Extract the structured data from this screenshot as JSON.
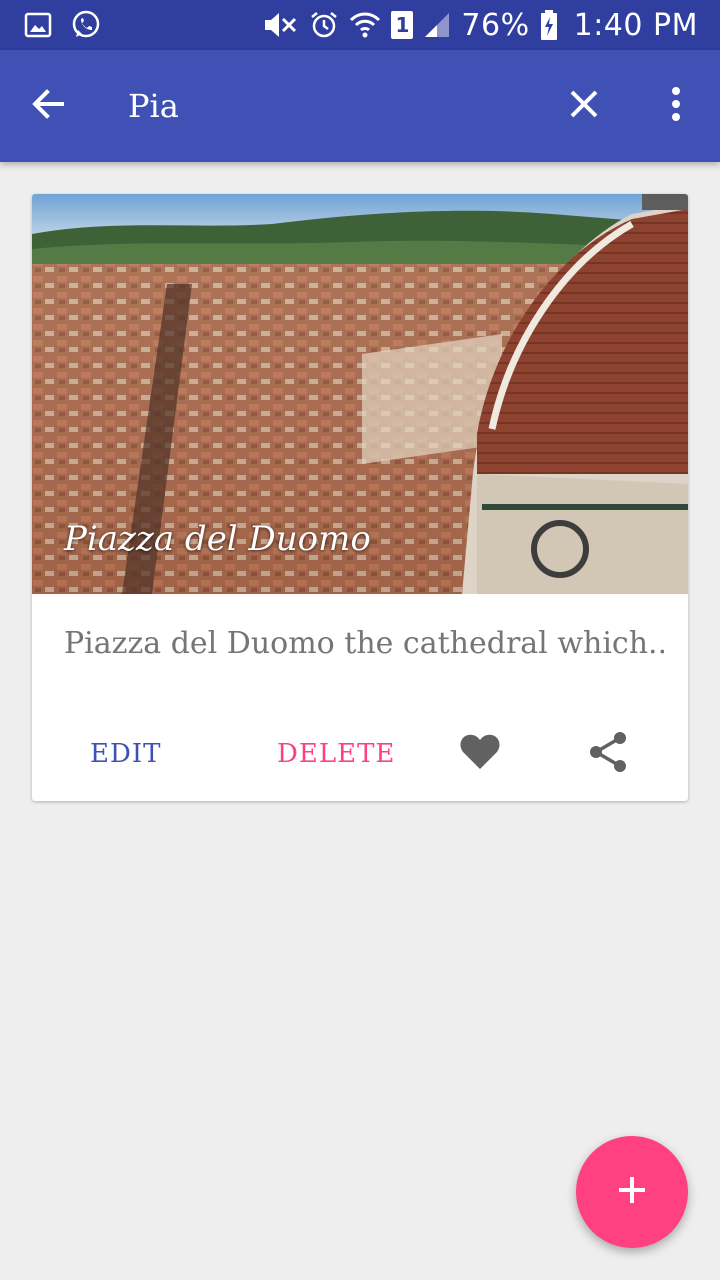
{
  "status_bar": {
    "battery": "76%",
    "time": "1:40 PM",
    "sim_slot": "1",
    "icons": [
      "gallery-icon",
      "whatsapp-icon",
      "vibrate-icon",
      "alarm-icon",
      "wifi-icon",
      "sim-icon",
      "signal-icon",
      "battery-icon"
    ]
  },
  "app_bar": {
    "search_value": "Pia",
    "icons": [
      "back-arrow-icon",
      "close-icon",
      "more-vert-icon"
    ]
  },
  "card": {
    "title": "Piazza del Duomo",
    "description": "Piazza del Duomo the cathedral which...",
    "edit_label": "EDIT",
    "delete_label": "DELETE",
    "icons": [
      "heart-icon",
      "share-icon"
    ]
  },
  "fab": {
    "icon": "add-icon"
  },
  "colors": {
    "primary": "#3f51b5",
    "primary_dark": "#303f9f",
    "accent": "#ff4081",
    "background": "#eeeeee"
  }
}
